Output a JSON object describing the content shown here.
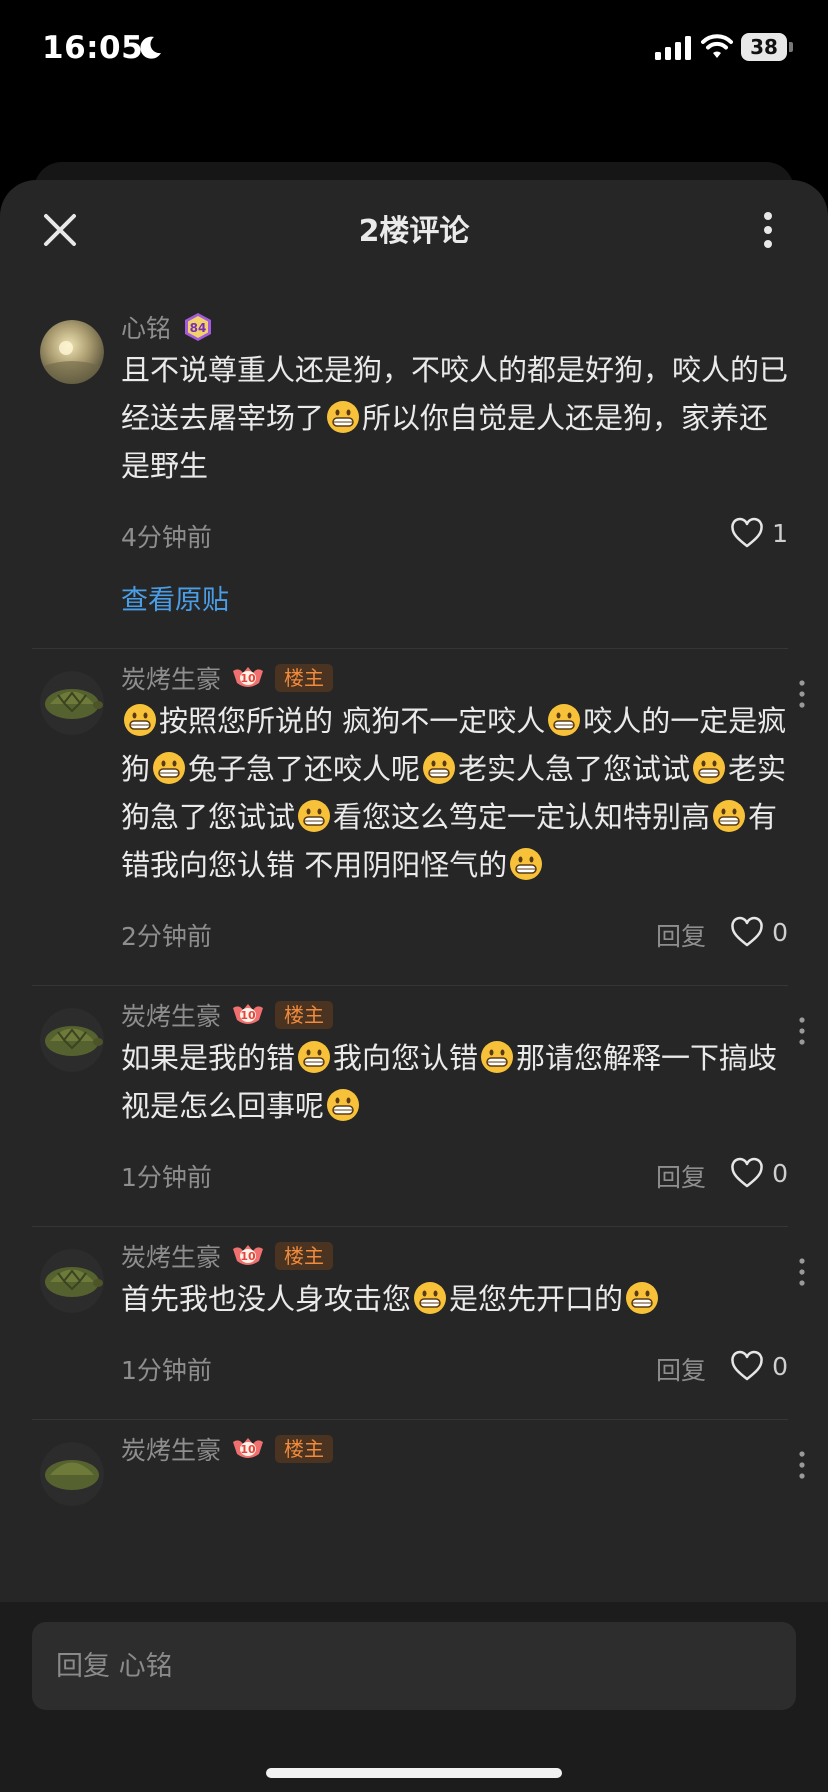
{
  "status_bar": {
    "time": "16:05",
    "battery": "38"
  },
  "header": {
    "title": "2楼评论"
  },
  "comments": [
    {
      "username": "心铭",
      "level": "84",
      "op_badge": "",
      "text_parts": [
        "且不说尊重人还是狗，不咬人的都是好狗，咬人的已经送去屠宰场了",
        "所以你自觉是人还是狗，家养还是野生"
      ],
      "time": "4分钟前",
      "reply_label": "",
      "likes": "1",
      "view_original": "查看原贴"
    },
    {
      "username": "炭烤生豪",
      "level": "10",
      "op_badge": "楼主",
      "text_parts": [
        "",
        "按照您所说的 疯狗不一定咬人",
        "咬人的一定是疯狗",
        "兔子急了还咬人呢",
        "老实人急了您试试",
        "老实狗急了您试试",
        "看您这么笃定一定认知特别高",
        "有错我向您认错 不用阴阳怪气的",
        ""
      ],
      "time": "2分钟前",
      "reply_label": "回复",
      "likes": "0"
    },
    {
      "username": "炭烤生豪",
      "level": "10",
      "op_badge": "楼主",
      "text_parts": [
        "如果是我的错",
        "我向您认错",
        "那请您解释一下搞歧视是怎么回事呢",
        ""
      ],
      "time": "1分钟前",
      "reply_label": "回复",
      "likes": "0"
    },
    {
      "username": "炭烤生豪",
      "level": "10",
      "op_badge": "楼主",
      "text_parts": [
        "首先我也没人身攻击您",
        "是您先开口的",
        ""
      ],
      "time": "1分钟前",
      "reply_label": "回复",
      "likes": "0"
    },
    {
      "username": "炭烤生豪",
      "level": "10",
      "op_badge": "楼主"
    }
  ],
  "reply_input": {
    "placeholder": "回复 心铭"
  },
  "icons": {
    "close": "close-icon",
    "more": "more-vertical-icon",
    "heart": "heart-outline-icon",
    "emoji": "grinning-emoji-icon"
  },
  "colors": {
    "background": "#262626",
    "link": "#4a9ee8",
    "op_badge": "#f08a3c",
    "level_badge": "#f07070"
  }
}
